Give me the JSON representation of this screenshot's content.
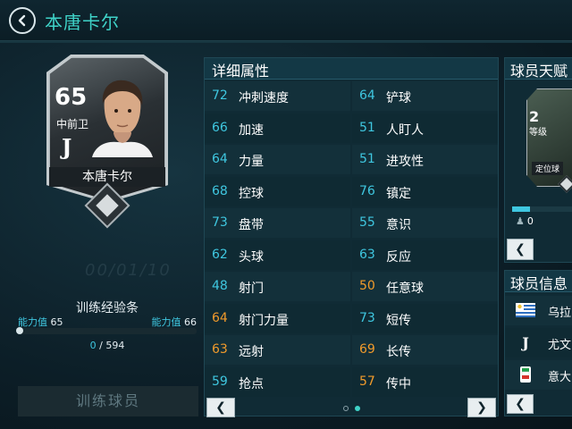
{
  "header": {
    "title": "本唐卡尔",
    "back_icon": "chevron-left-icon"
  },
  "player_card": {
    "rating": "65",
    "position": "中前卫",
    "club_icon": "juventus-logo-icon",
    "name": "本唐卡尔"
  },
  "faded_background_text": "00/01/10",
  "training": {
    "title": "训练经验条",
    "level_left_label": "能力值",
    "level_left_value": "65",
    "level_right_label": "能力值",
    "level_right_value": "66",
    "xp_current": "0",
    "xp_separator": " / ",
    "xp_total": "594",
    "xp_progress": 0,
    "button_label": "训练球员"
  },
  "details": {
    "title": "详细属性",
    "rows": [
      {
        "left": {
          "value": "72",
          "label": "冲刺速度",
          "color": "blue"
        },
        "right": {
          "value": "64",
          "label": "铲球",
          "color": "blue"
        }
      },
      {
        "left": {
          "value": "66",
          "label": "加速",
          "color": "blue"
        },
        "right": {
          "value": "51",
          "label": "人盯人",
          "color": "blue"
        }
      },
      {
        "left": {
          "value": "64",
          "label": "力量",
          "color": "blue"
        },
        "right": {
          "value": "51",
          "label": "进攻性",
          "color": "blue"
        }
      },
      {
        "left": {
          "value": "68",
          "label": "控球",
          "color": "blue"
        },
        "right": {
          "value": "76",
          "label": "镇定",
          "color": "blue"
        }
      },
      {
        "left": {
          "value": "73",
          "label": "盘带",
          "color": "blue"
        },
        "right": {
          "value": "55",
          "label": "意识",
          "color": "blue"
        }
      },
      {
        "left": {
          "value": "62",
          "label": "头球",
          "color": "blue"
        },
        "right": {
          "value": "63",
          "label": "反应",
          "color": "blue"
        }
      },
      {
        "left": {
          "value": "48",
          "label": "射门",
          "color": "blue"
        },
        "right": {
          "value": "50",
          "label": "任意球",
          "color": "orange"
        }
      },
      {
        "left": {
          "value": "64",
          "label": "射门力量",
          "color": "orange"
        },
        "right": {
          "value": "73",
          "label": "短传",
          "color": "blue"
        }
      },
      {
        "left": {
          "value": "63",
          "label": "远射",
          "color": "orange"
        },
        "right": {
          "value": "69",
          "label": "长传",
          "color": "orange"
        }
      },
      {
        "left": {
          "value": "59",
          "label": "抢点",
          "color": "blue"
        },
        "right": {
          "value": "57",
          "label": "传中",
          "color": "orange"
        }
      }
    ],
    "page_count": 2,
    "current_page": 2
  },
  "talent": {
    "title": "球员天赋",
    "level": "2",
    "level_label": "等级",
    "card_name": "定位球",
    "count": "0",
    "count_icon": "person-icon"
  },
  "info": {
    "title": "球员信息",
    "rows": [
      {
        "icon": "uruguay-flag-icon",
        "text": "乌拉"
      },
      {
        "icon": "juventus-logo-icon",
        "text": "尤文"
      },
      {
        "icon": "serie-a-logo-icon",
        "text": "意大"
      }
    ]
  },
  "colors": {
    "accent_teal": "#3fd3c8",
    "stat_blue": "#3fc7e0",
    "stat_orange": "#f29b2b",
    "panel_bg": "#102b35"
  }
}
